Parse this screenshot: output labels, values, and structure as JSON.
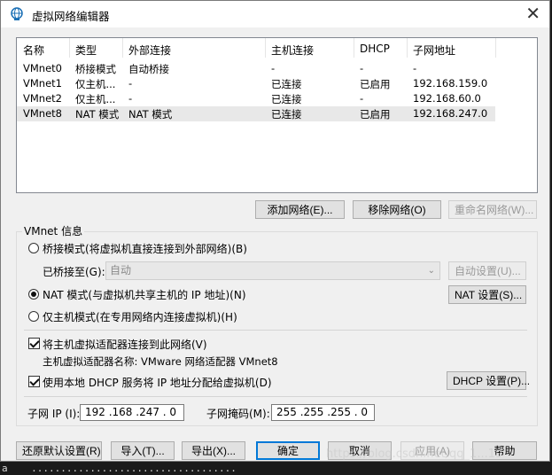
{
  "window": {
    "title": "虚拟网络编辑器",
    "close_glyph": "✕"
  },
  "table": {
    "columns": [
      "名称",
      "类型",
      "外部连接",
      "主机连接",
      "DHCP",
      "子网地址"
    ],
    "rows": [
      [
        "VMnet0",
        "桥接模式",
        "自动桥接",
        "-",
        "-",
        "-"
      ],
      [
        "VMnet1",
        "仅主机...",
        "-",
        "已连接",
        "已启用",
        "192.168.159.0"
      ],
      [
        "VMnet2",
        "仅主机...",
        "-",
        "已连接",
        "-",
        "192.168.60.0"
      ],
      [
        "VMnet8",
        "NAT 模式",
        "NAT 模式",
        "已连接",
        "已启用",
        "192.168.247.0"
      ]
    ],
    "selected_index": 3
  },
  "net_buttons": {
    "add": "添加网络(E)...",
    "remove": "移除网络(O)",
    "rename": "重命名网络(W)..."
  },
  "vmnet_info": {
    "label": "VMnet 信息",
    "bridge_label": "桥接模式(将虚拟机直接连接到外部网络)(B)",
    "bridged_to_label": "已桥接至(G):",
    "bridged_to_value": "自动",
    "auto_settings": "自动设置(U)...",
    "nat_label": "NAT 模式(与虚拟机共享主机的 IP 地址)(N)",
    "nat_settings": "NAT 设置(S)...",
    "host_only_label": "仅主机模式(在专用网络内连接虚拟机)(H)",
    "selected_mode": "nat",
    "connect_adapter_label": "将主机虚拟适配器连接到此网络(V)",
    "connect_adapter_checked": true,
    "adapter_name_label": "主机虚拟适配器名称: VMware 网络适配器 VMnet8",
    "dhcp_label": "使用本地 DHCP 服务将 IP 地址分配给虚拟机(D)",
    "dhcp_checked": true,
    "dhcp_settings": "DHCP 设置(P)...",
    "subnet_ip_label": "子网 IP (I):",
    "subnet_ip_value": "192 .168 .247 . 0",
    "subnet_mask_label": "子网掩码(M):",
    "subnet_mask_value": "255 .255 .255 . 0"
  },
  "footer_buttons": {
    "restore": "还原默认设置(R)",
    "import": "导入(T)...",
    "export": "导出(X)...",
    "ok": "确定",
    "cancel": "取消",
    "apply": "应用(A)",
    "help": "帮助"
  },
  "watermark": "https://blog.csdn.net/qq_1...19",
  "colors": {
    "selected_row": "#e8e8e8",
    "default_button_border": "#0078d7",
    "dialog_bg": "#f0f0f0"
  }
}
